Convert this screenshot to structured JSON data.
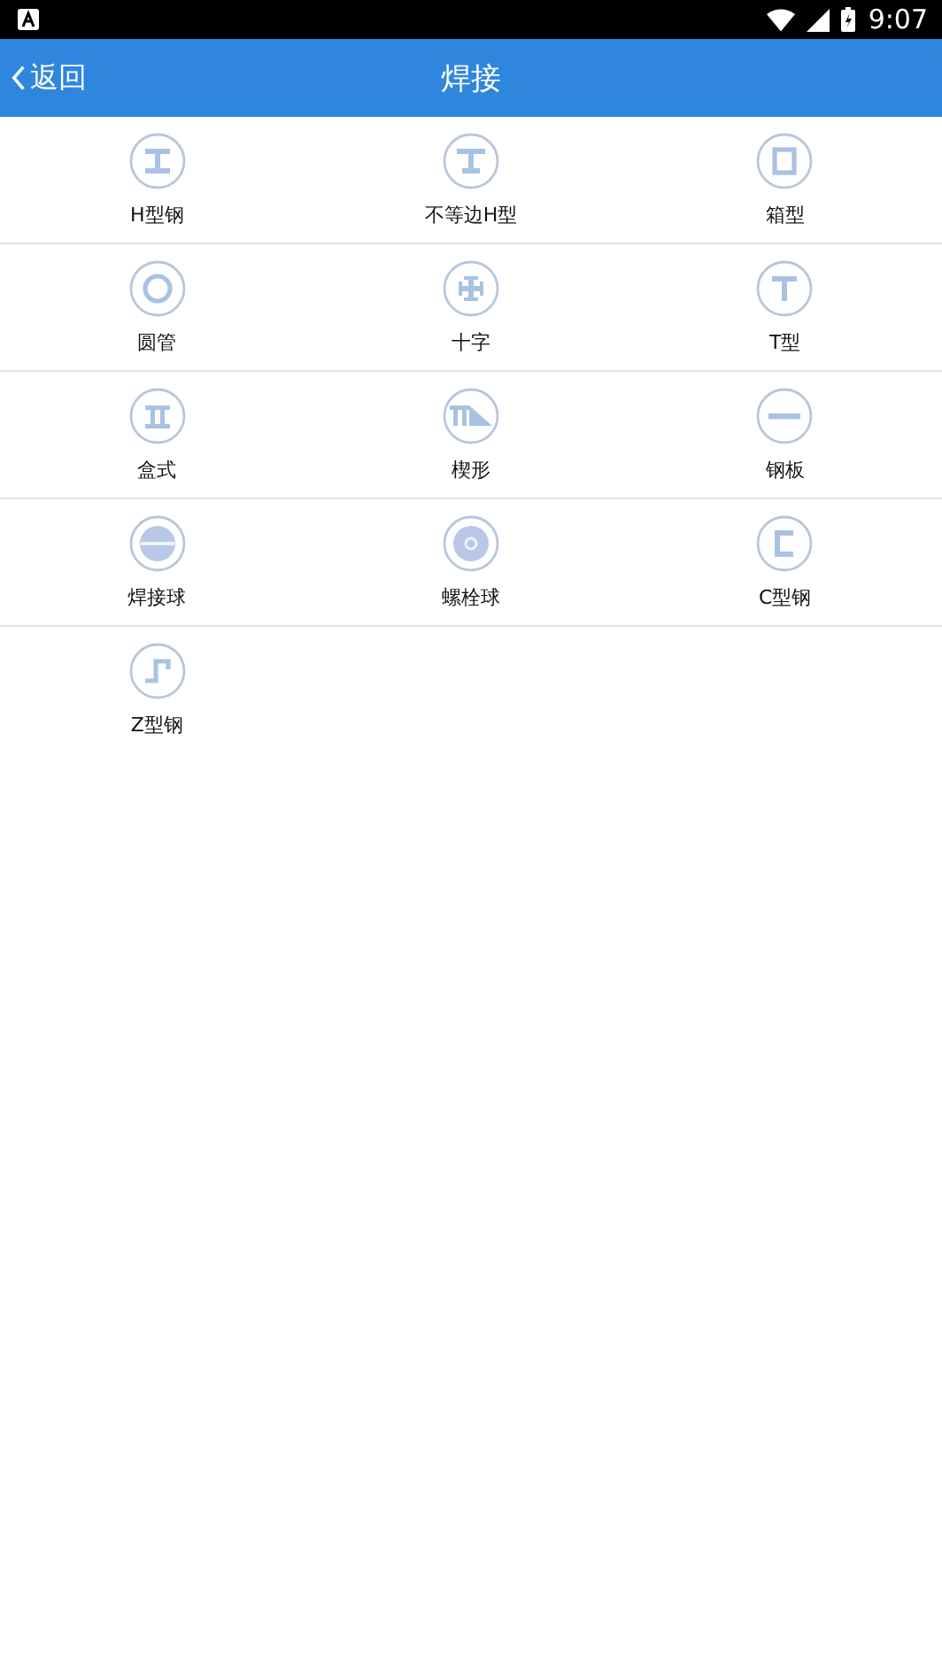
{
  "status_bar": {
    "time": "9:07"
  },
  "header": {
    "back": "返回",
    "title": "焊接"
  },
  "items": [
    {
      "label": "H型钢",
      "kind": "h-beam"
    },
    {
      "label": "不等边H型",
      "kind": "unequal-h"
    },
    {
      "label": "箱型",
      "kind": "box"
    },
    {
      "label": "圆管",
      "kind": "pipe"
    },
    {
      "label": "十字",
      "kind": "cross"
    },
    {
      "label": "T型",
      "kind": "t-beam"
    },
    {
      "label": "盒式",
      "kind": "double-web"
    },
    {
      "label": "楔形",
      "kind": "wedge"
    },
    {
      "label": "钢板",
      "kind": "plate"
    },
    {
      "label": "焊接球",
      "kind": "weld-ball"
    },
    {
      "label": "螺栓球",
      "kind": "bolt-ball"
    },
    {
      "label": "C型钢",
      "kind": "c-channel"
    },
    {
      "label": "Z型钢",
      "kind": "z-section"
    }
  ]
}
